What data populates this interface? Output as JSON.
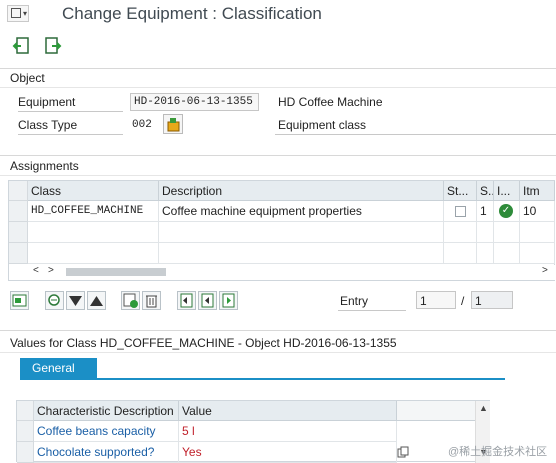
{
  "window": {
    "title": "Change Equipment : Classification"
  },
  "object_section": {
    "title": "Object",
    "equipment_label": "Equipment",
    "equipment_value": "HD-2016-06-13-1355",
    "equipment_desc": "HD Coffee Machine",
    "class_type_label": "Class Type",
    "class_type_value": "002",
    "class_type_desc": "Equipment class"
  },
  "assignments": {
    "title": "Assignments",
    "columns": [
      "Class",
      "Description",
      "St...",
      "S...",
      "I...",
      "Itm"
    ],
    "rows": [
      {
        "class": "HD_COFFEE_MACHINE",
        "description": "Coffee machine equipment properties",
        "s": "1",
        "itm": "10"
      }
    ],
    "entry_label": "Entry",
    "entry_value": "1",
    "entry_sep": "/",
    "entry_total": "1"
  },
  "values_section": {
    "title": "Values for Class HD_COFFEE_MACHINE - Object HD-2016-06-13-1355",
    "tab_label": "General",
    "columns": [
      "Characteristic Description",
      "Value"
    ],
    "rows": [
      {
        "desc": "Coffee beans capacity",
        "value": "5 l"
      },
      {
        "desc": "Chocolate supported?",
        "value": "Yes"
      }
    ]
  },
  "watermark": "@稀土掘金技术社区",
  "colors": {
    "tab": "#1b8fc6",
    "value_red": "#c0202a",
    "link": "#1a5fa6"
  }
}
